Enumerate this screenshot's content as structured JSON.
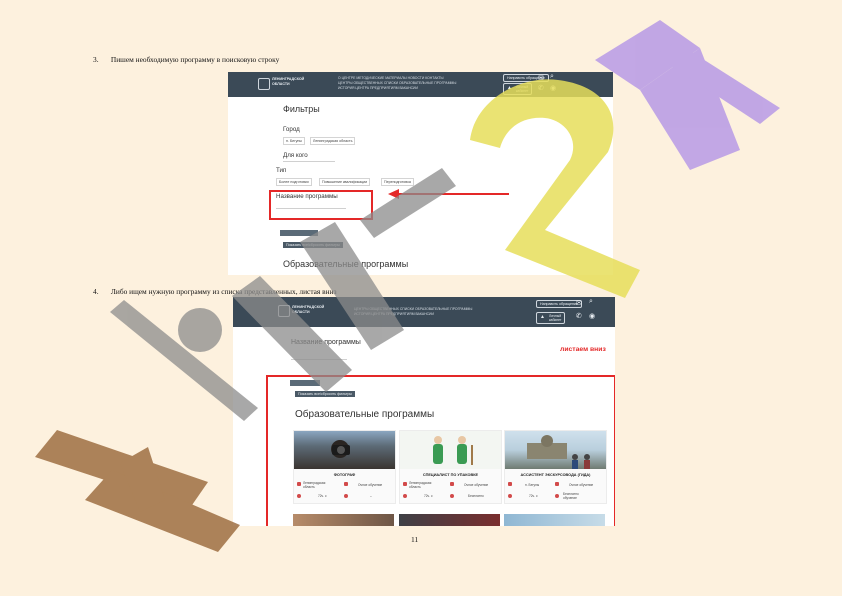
{
  "steps": [
    {
      "number": "3.",
      "text": "Пишем необходимую программу в поисковую строку"
    },
    {
      "number": "4.",
      "text": "Либо ищем нужную программу из списка представленных, листая вниз"
    }
  ],
  "page_number": "11",
  "screenshot1": {
    "nav": {
      "logo_text": "ЛЕНИНГРАДСКОЙ\nОБЛАСТИ",
      "menu_text": "О ЦЕНТРЕ   МЕТОДИЧЕСКИЕ МАТЕРИАЛЫ   НОВОСТИ   КОНТАКТЫ\nЦЕНТРЫ ОБЩЕСТВЕННЫХ   СПИСКИ   ОБРАЗОВАТЕЛЬНЫЕ ПРОГРАММЫ\nИСТОРИЯ ЦЕНТРА   ПРЕДПРИЯТИЯМ   ВАКАНСИИ",
      "button": "Направить обращение",
      "cabinet": "Личный\nкабинет"
    },
    "filters_title": "Фильтры",
    "city_label": "Город",
    "city_chips": [
      "п. Бегуны",
      "Ленинградская область"
    ],
    "for_whom_label": "Для кого",
    "type_label": "Тип",
    "type_chips": [
      "Более подготовки",
      "Повышение квалификации",
      "Переподготовка"
    ],
    "program_name_label": "Название программы",
    "button_show": "Показать все/сбросить фильтры",
    "section_title": "Образовательные программы"
  },
  "screenshot2": {
    "nav": {
      "logo_text": "ЛЕНИНГРАДСКОЙ\nОБЛАСТИ",
      "menu_text": "ЦЕНТРЫ ОБЩЕСТВЕННЫХ   СПИСКИ   ОБРАЗОВАТЕЛЬНЫЕ ПРОГРАММЫ\nИСТОРИЯ ЦЕНТРА   ПРЕДПРИЯТИЯМ   ВАКАНСИИ",
      "button": "Направить обращение",
      "cabinet": "Личный\nкабинет"
    },
    "program_name_label": "Название программы",
    "scroll_hint": "листаем вниз",
    "button_show": "Показать все/сбросить фильтры",
    "section_title": "Образовательные программы",
    "cards": [
      {
        "title": "ФОТОГРАФ",
        "location": "Ленинградская\nобласть",
        "format": "Очное обучение",
        "hours": "72ч. с",
        "price": "–"
      },
      {
        "title": "СПЕЦИАЛИСТ ПО УПАКОВКЕ",
        "location": "Ленинградская\nобласть",
        "format": "Очное обучение",
        "hours": "72ч. с",
        "price": "Бесплатно"
      },
      {
        "title": "АССИСТЕНТ ЭКСКУРСОВОДА (ГИДА)",
        "location": "п. Бегуны",
        "format": "Очное обучение",
        "hours": "72ч. с",
        "price": "Бесплатно\nобучение"
      }
    ]
  },
  "watermark": "Hill24",
  "colors": {
    "accent_red": "#e42828",
    "nav_bg": "#3b4a57",
    "page_bg": "#fdf1de",
    "watermark_yellow": "#e6de5a",
    "watermark_purple": "#b79ae6",
    "watermark_gray": "#8c8c8c",
    "watermark_brown": "#9b6a3c"
  }
}
